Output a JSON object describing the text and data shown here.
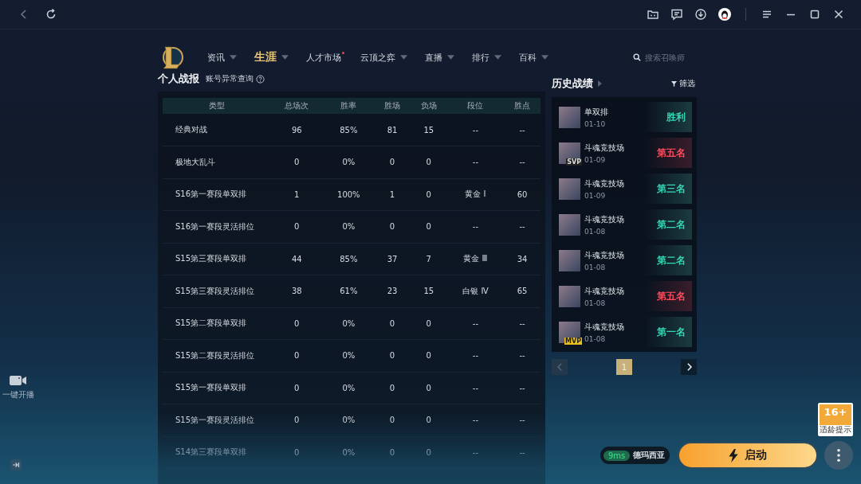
{
  "nav": {
    "items": [
      {
        "label": "资讯",
        "selected": false,
        "has_menu": true,
        "dot": false
      },
      {
        "label": "生涯",
        "selected": true,
        "has_menu": true,
        "dot": false
      },
      {
        "label": "人才市场",
        "selected": false,
        "has_menu": false,
        "dot": true
      },
      {
        "label": "云顶之弈",
        "selected": false,
        "has_menu": true,
        "dot": false
      },
      {
        "label": "直播",
        "selected": false,
        "has_menu": true,
        "dot": false
      },
      {
        "label": "排行",
        "selected": false,
        "has_menu": true,
        "dot": false
      },
      {
        "label": "百科",
        "selected": false,
        "has_menu": true,
        "dot": false
      }
    ],
    "search": {
      "placeholder": "搜索召唤师"
    }
  },
  "stats": {
    "title": "个人战报",
    "link": "账号异常查询",
    "table": {
      "columns": [
        "类型",
        "总场次",
        "胜率",
        "胜场",
        "负场",
        "段位",
        "胜点"
      ],
      "rows": [
        [
          "经典对战",
          "96",
          "85%",
          "81",
          "15",
          "--",
          "--"
        ],
        [
          "极地大乱斗",
          "0",
          "0%",
          "0",
          "0",
          "--",
          "--"
        ],
        [
          "S16第一赛段单双排",
          "1",
          "100%",
          "1",
          "0",
          "黄金 Ⅰ",
          "60"
        ],
        [
          "S16第一赛段灵活排位",
          "0",
          "0%",
          "0",
          "0",
          "--",
          "--"
        ],
        [
          "S15第三赛段单双排",
          "44",
          "85%",
          "37",
          "7",
          "黄金 Ⅲ",
          "34"
        ],
        [
          "S15第三赛段灵活排位",
          "38",
          "61%",
          "23",
          "15",
          "白银 Ⅳ",
          "65"
        ],
        [
          "S15第二赛段单双排",
          "0",
          "0%",
          "0",
          "0",
          "--",
          "--"
        ],
        [
          "S15第二赛段灵活排位",
          "0",
          "0%",
          "0",
          "0",
          "--",
          "--"
        ],
        [
          "S15第一赛段单双排",
          "0",
          "0%",
          "0",
          "0",
          "--",
          "--"
        ],
        [
          "S15第一赛段灵活排位",
          "0",
          "0%",
          "0",
          "0",
          "--",
          "--"
        ],
        [
          "S14第三赛段单双排",
          "0",
          "0%",
          "0",
          "0",
          "--",
          "--"
        ]
      ]
    }
  },
  "history": {
    "title": "历史战绩",
    "filter": "筛选",
    "matches": [
      {
        "mode": "单双排",
        "date": "01-10",
        "result": "胜利",
        "kind": "win"
      },
      {
        "mode": "斗魂竞技场",
        "date": "01-09",
        "result": "第五名",
        "kind": "loss",
        "badge": "SVP"
      },
      {
        "mode": "斗魂竞技场",
        "date": "01-09",
        "result": "第三名",
        "kind": "win"
      },
      {
        "mode": "斗魂竞技场",
        "date": "01-08",
        "result": "第二名",
        "kind": "win"
      },
      {
        "mode": "斗魂竞技场",
        "date": "01-08",
        "result": "第二名",
        "kind": "win"
      },
      {
        "mode": "斗魂竞技场",
        "date": "01-08",
        "result": "第五名",
        "kind": "loss"
      },
      {
        "mode": "斗魂竞技场",
        "date": "01-08",
        "result": "第一名",
        "kind": "win",
        "badge": "MVP"
      }
    ],
    "pager": {
      "prev_disabled": true,
      "pages": [
        {
          "label": "1",
          "selected": true
        }
      ]
    }
  },
  "sidebar": {
    "live_label": "一键开播"
  },
  "launch": {
    "ping": "9ms",
    "server": "德玛西亚",
    "button": "启动"
  },
  "age_rating": {
    "label": "16+",
    "caption": "适龄提示"
  }
}
